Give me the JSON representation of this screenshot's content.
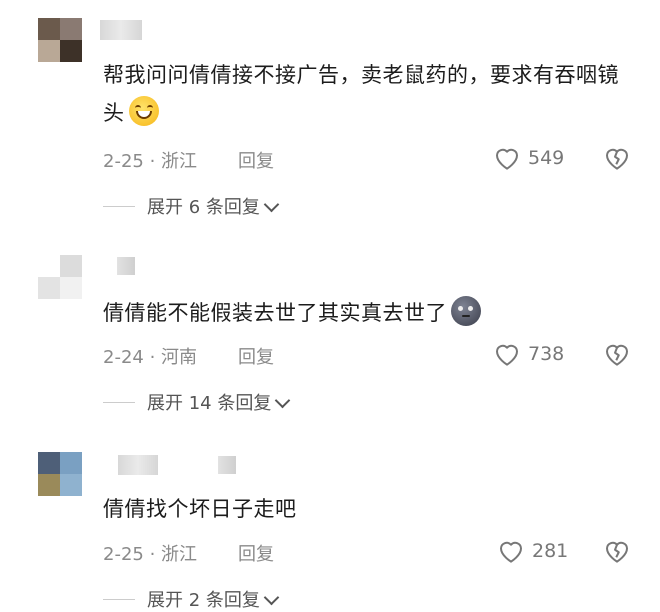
{
  "comments": [
    {
      "text": "帮我问问倩倩接不接广告，卖老鼠药的，要求有吞咽镜头",
      "emoji": "grinning-face-emoji",
      "date_location": "2-25 · 浙江",
      "reply_label": "回复",
      "likes": "549",
      "expand_label": "展开 6 条回复",
      "avatar_colors": [
        "#6b5a4c",
        "#8a7a72",
        "#b9a896",
        "#3d3128"
      ]
    },
    {
      "text": "倩倩能不能假装去世了其实真去世了",
      "emoji": "new-moon-face-emoji",
      "date_location": "2-24 · 河南",
      "reply_label": "回复",
      "likes": "738",
      "expand_label": "展开 14 条回复",
      "avatar_colors": [
        "#ffffff",
        "#dcdcdc",
        "#e3e3e3",
        "#f1f1f1"
      ]
    },
    {
      "text": "倩倩找个坏日子走吧",
      "emoji": "",
      "date_location": "2-25 · 浙江",
      "reply_label": "回复",
      "likes": "281",
      "expand_label": "展开 2 条回复",
      "avatar_colors": [
        "#4e5f78",
        "#7aa0c2",
        "#9a8a5a",
        "#8fb2cf"
      ]
    }
  ],
  "icons": {
    "like": "heart-outline-icon",
    "dislike": "broken-heart-icon",
    "expand": "chevron-down-icon"
  }
}
